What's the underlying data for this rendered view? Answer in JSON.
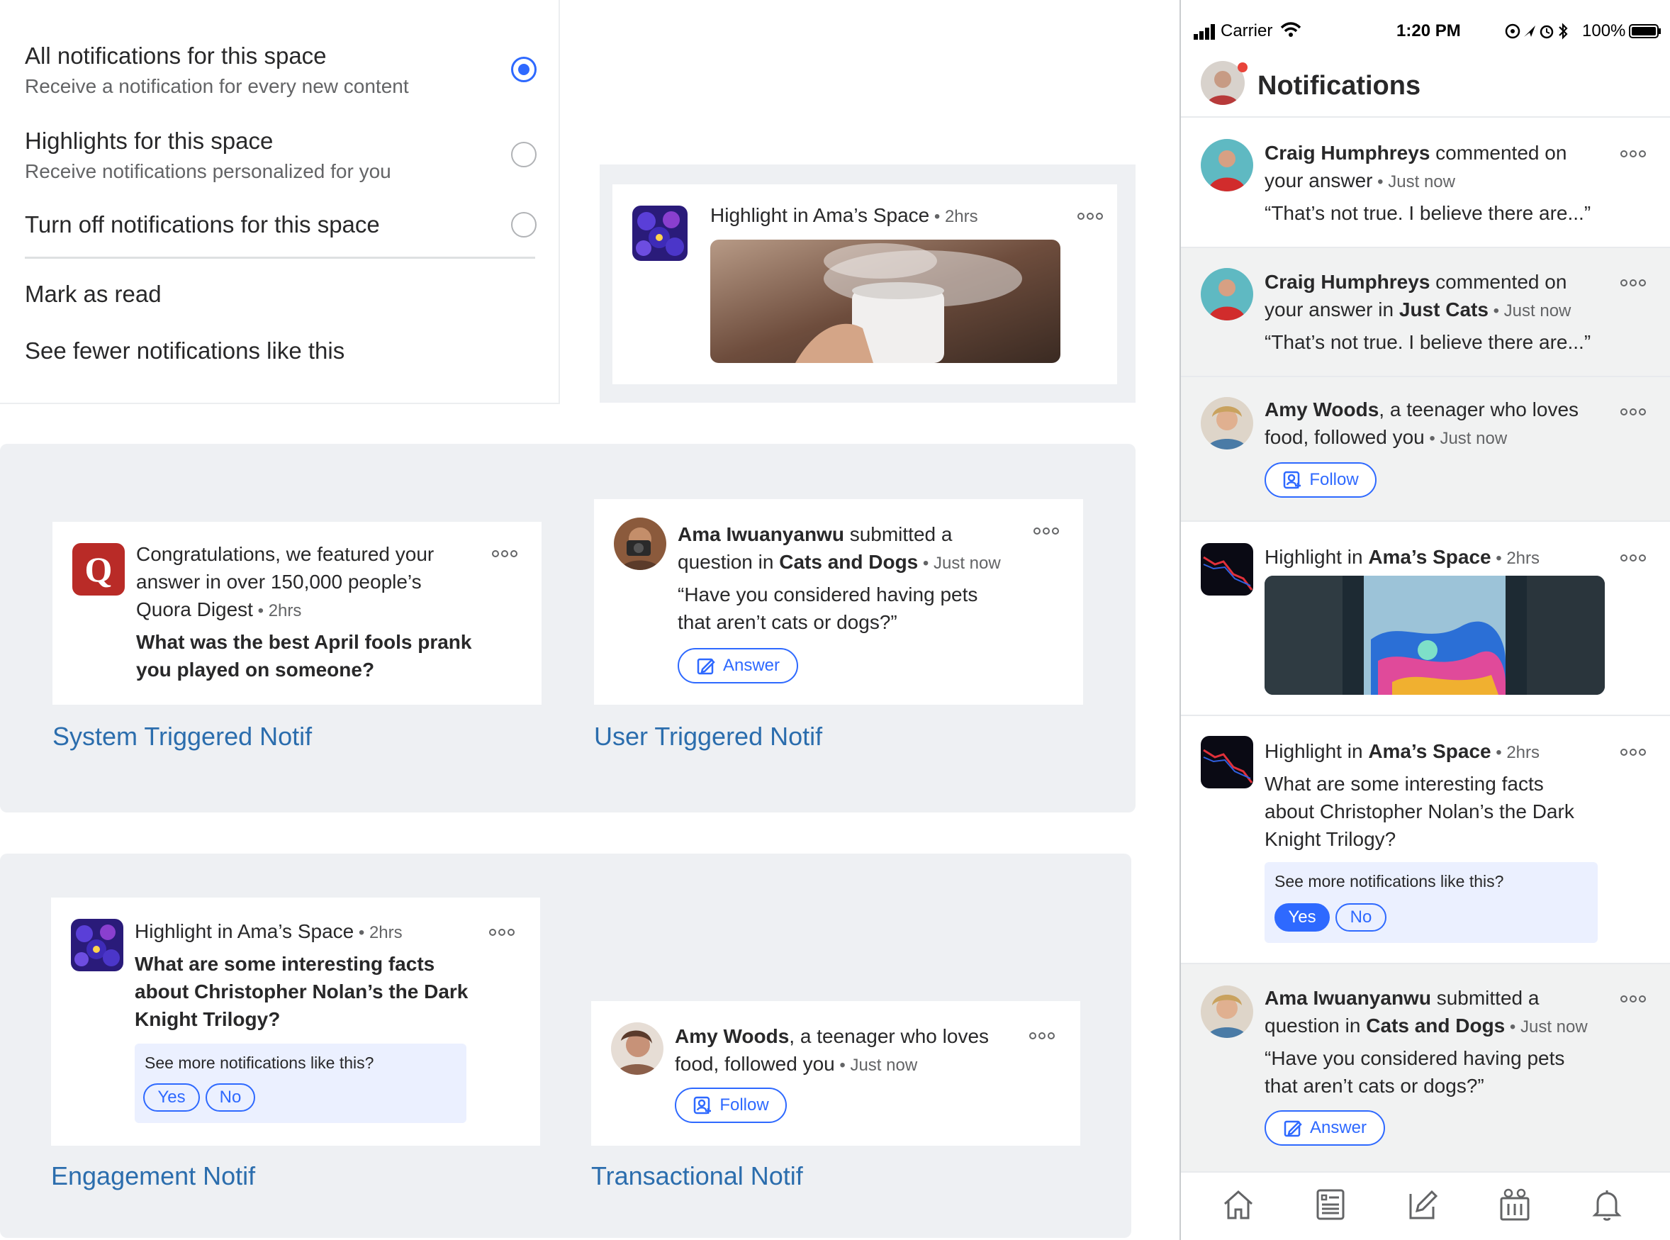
{
  "settings_menu": {
    "options": [
      {
        "title": "All notifications for this space",
        "subtitle": "Receive a notification for every new content",
        "selected": true
      },
      {
        "title": "Highlights for this space",
        "subtitle": "Receive notifications personalized for you",
        "selected": false
      },
      {
        "title": "Turn off notifications for this space",
        "subtitle": "",
        "selected": false
      }
    ],
    "actions": [
      "Mark as read",
      "See fewer notifications like this"
    ]
  },
  "highlight_card": {
    "prefix": "Highlight in Ama’s Space",
    "time": " • 2hrs"
  },
  "system_card": {
    "line1": "Congratulations, we featured your",
    "line2": "answer in over 150,000 people’s",
    "line3": "Quora Digest",
    "time": " • 2hrs",
    "q1": "What was the best April fools prank",
    "q2": "you played on someone?",
    "logo": "Q",
    "caption": "System Triggered Notif"
  },
  "user_card": {
    "name": "Ama Iwuanyanwu",
    "l1_rest": " submitted a",
    "l2_pre": "question in ",
    "space": "Cats and Dogs",
    "time": " • Just now",
    "quote1": "“Have you considered having pets",
    "quote2": "that aren’t cats or dogs?”",
    "button": "Answer",
    "caption": "User Triggered Notif"
  },
  "engagement_card": {
    "prefix": "Highlight in Ama’s Space",
    "time": " • 2hrs",
    "q1": "What are some interesting facts",
    "q2": "about Christopher Nolan’s the Dark",
    "q3": "Knight Trilogy?",
    "prompt": "See more notifications like this?",
    "yes": "Yes",
    "no": "No",
    "caption": "Engagement Notif"
  },
  "transactional_card": {
    "name": "Amy Woods",
    "l1_rest": ", a teenager who loves",
    "l2": "food, followed you",
    "time": " • Just now",
    "button": "Follow",
    "caption": "Transactional Notif"
  },
  "phone": {
    "status": {
      "carrier": "Carrier",
      "time": "1:20 PM",
      "battery": "100%"
    },
    "title": "Notifications",
    "items": [
      {
        "name": "Craig Humphreys",
        "l1_rest": " commented on",
        "l2": "your answer",
        "time": " • Just now",
        "quote": "“That’s not true. I believe there are...”"
      },
      {
        "name": "Craig Humphreys",
        "l1_rest": " commented on",
        "l2_pre": "your answer in ",
        "space": "Just Cats",
        "time": " • Just now",
        "quote": "“That’s not true. I believe there are...”"
      },
      {
        "name": "Amy Woods",
        "l1_rest": ", a teenager who loves",
        "l2": "food, followed you",
        "time": " • Just now",
        "button": "Follow"
      },
      {
        "pre": "Highlight in ",
        "space": "Ama’s Space",
        "time": " • 2hrs"
      },
      {
        "pre": "Highlight in ",
        "space": "Ama’s Space",
        "time": " • 2hrs",
        "q1": "What are some interesting facts",
        "q2": "about Christopher Nolan’s the Dark",
        "q3": "Knight Trilogy?",
        "prompt": "See more notifications like this?",
        "yes": "Yes",
        "no": "No"
      },
      {
        "name": "Ama Iwuanyanwu",
        "l1_rest": " submitted a",
        "l2_pre": "question in ",
        "space": "Cats and Dogs",
        "time": " • Just now",
        "quote1": "“Have you considered having pets",
        "quote2": "that aren’t cats or dogs?”",
        "button": "Answer"
      }
    ],
    "tabs": [
      "home-icon",
      "following-icon",
      "write-icon",
      "spaces-icon",
      "notifications-icon"
    ]
  },
  "colors": {
    "accent": "#2e69ff",
    "caption": "#2b6dad",
    "panel": "#eef0f3",
    "quora_red": "#b92b27"
  }
}
